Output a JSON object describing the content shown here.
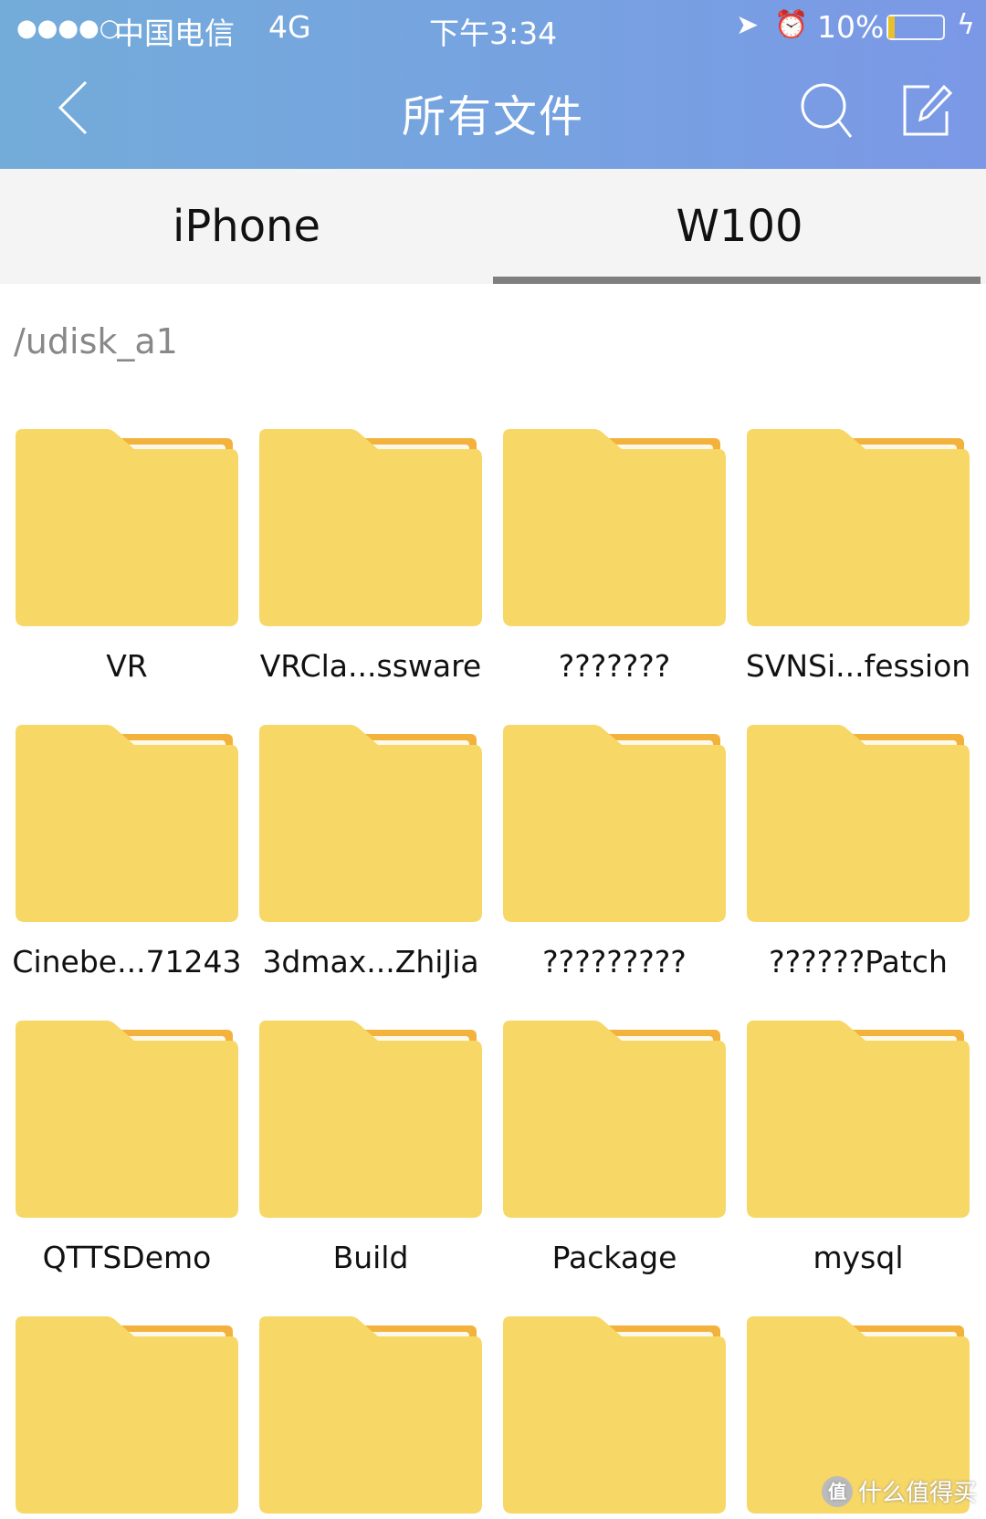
{
  "status_bar": {
    "signal": "●●●●○",
    "carrier": "中国电信",
    "network": "4G",
    "time": "下午3:34",
    "battery": "10%"
  },
  "header": {
    "title": "所有文件",
    "back_icon": "chevron-left-icon",
    "search_icon": "search-icon",
    "edit_icon": "edit-icon"
  },
  "tabs": [
    {
      "label": "iPhone",
      "active": false
    },
    {
      "label": "W100",
      "active": true
    }
  ],
  "path": "/udisk_a1",
  "folders": [
    {
      "name": "VR"
    },
    {
      "name": "VRCla...ssware"
    },
    {
      "name": "???????"
    },
    {
      "name": "SVNSi...fession"
    },
    {
      "name": "Cinebe...71243"
    },
    {
      "name": "3dmax...ZhiJia"
    },
    {
      "name": "?????????"
    },
    {
      "name": "??????Patch"
    },
    {
      "name": "QTTSDemo"
    },
    {
      "name": "Build"
    },
    {
      "name": "Package"
    },
    {
      "name": "mysql"
    },
    {
      "name": ""
    },
    {
      "name": ""
    },
    {
      "name": ""
    },
    {
      "name": ""
    }
  ],
  "watermark": "什么值得买",
  "colors": {
    "folder": "#f7d765",
    "folder_back": "#f3b23c",
    "accent_underline": "#7f7f7f"
  }
}
